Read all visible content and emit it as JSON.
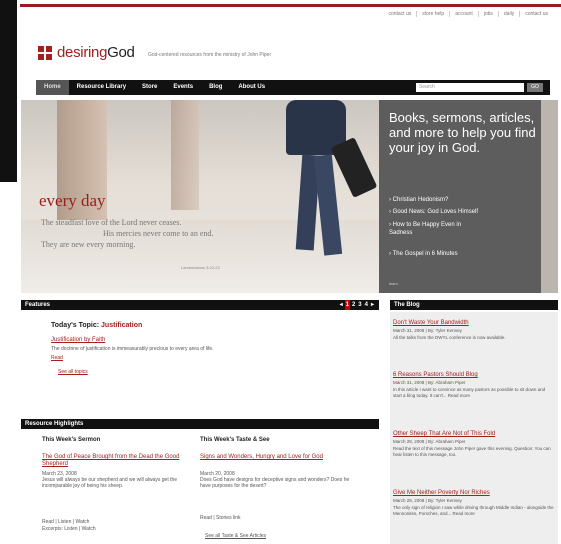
{
  "utility_nav": [
    "contact us",
    "store help",
    "account",
    "jobs",
    "daily",
    "contact us"
  ],
  "logo": {
    "name_part1": "desiring",
    "name_part2": "God",
    "tagline": "God-centered resources from the ministry of John Piper"
  },
  "main_nav": [
    "Home",
    "Resource Library",
    "Store",
    "Events",
    "Blog",
    "About Us"
  ],
  "search": {
    "placeholder": "Search",
    "button": "GO"
  },
  "hero": {
    "headline": "every day",
    "quote_lines": [
      "The steadfast love of the Lord never ceases.",
      "His mercies never come to an end.",
      "They are new every morning."
    ],
    "reference": "Lamentations 3:22-23",
    "panel_heading": "Books, sermons, articles, and more to help you find your joy in God.",
    "panel_links": [
      "Christian Hedonism?",
      "Good News: God Loves Himself",
      "How to Be Happy Even in Sadness",
      "The Gospel in 6 Minutes"
    ],
    "panel_more": "learn"
  },
  "features": {
    "heading": "Features",
    "pager": [
      "1",
      "2",
      "3",
      "4"
    ],
    "topic_label": "Today's Topic:",
    "topic": "Justification",
    "article_title": "Justification by Faith",
    "article_desc": "The doctrine of justification is immeasurably precious to every area of life.",
    "read": "Read",
    "see_all": "See all topics"
  },
  "resources": {
    "heading": "Resource Highlights",
    "sermon_heading": "This Week's Sermon",
    "sermon_title": "The God of Peace Brought from the Dead the Good Shepherd",
    "sermon_date": "March 23, 2008",
    "sermon_desc": "Jesus will always be our shepherd and we will always get the incomparable joy of being his sheep.",
    "sermon_links": "Read | Listen | Watch",
    "sermon_excerpt": "Excerpts: Listen | Watch",
    "taste_heading": "This Week's Taste & See",
    "taste_title": "Signs and Wonders, Hungry and Love for God",
    "taste_date": "March 20, 2008",
    "taste_desc": "Does God have designs for deceptive signs and wonders? Does he have purposes for the desert?",
    "taste_links": "Read | Stories link",
    "taste_see_all": "See all Taste & See Articles"
  },
  "blog": {
    "heading": "The Blog",
    "items": [
      {
        "title": "Don't Waste Your Bandwidth",
        "meta": "March 31, 2008 | By: Tyler Kenney",
        "desc": "All the talks from the DWYL conference is now available."
      },
      {
        "title": "6 Reasons Pastors Should Blog",
        "meta": "March 31, 2008 | By: Abraham Piper",
        "desc": "In this article I want to convince as many pastors as possible to sit down and start a blog today. It can't... Read more"
      },
      {
        "title": "Other Sheep That Are Not of This Fold",
        "meta": "March 28, 2008 | By: Abraham Piper",
        "desc": "Read the text of this message John Piper gave this evening. Question: You can hear listen to this message, too."
      },
      {
        "title": "Give Me Neither Poverty Nor Riches",
        "meta": "March 28, 2008 | By: Tyler Kenney",
        "desc": "The only sign of religion I saw while driving through Middle Indian - alongside the Mennonites, Porsches, and... Read more"
      }
    ]
  }
}
